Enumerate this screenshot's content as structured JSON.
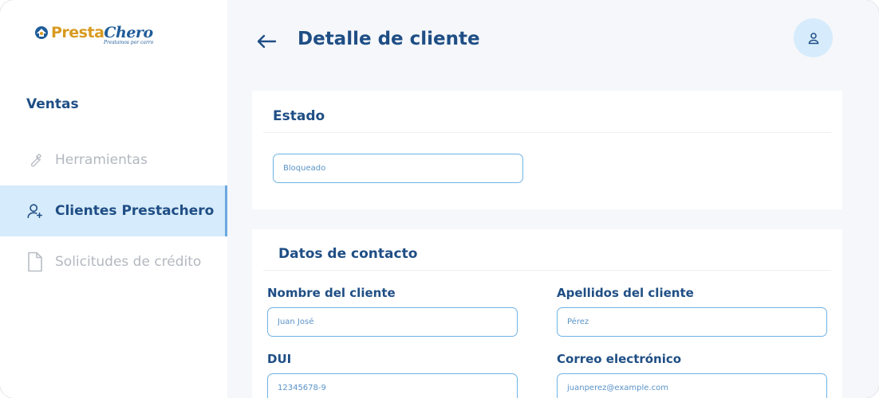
{
  "brand": {
    "name_part1": "Presta",
    "name_part2": "Chero",
    "tagline": "Prestamos por carro"
  },
  "sidebar": {
    "section_title": "Ventas",
    "items": [
      {
        "label": "Herramientas",
        "icon": "wrench-icon",
        "active": false
      },
      {
        "label": "Clientes Prestachero",
        "icon": "user-plus-icon",
        "active": true
      },
      {
        "label": "Solicitudes de crédito",
        "icon": "document-icon",
        "active": false
      }
    ]
  },
  "header": {
    "title": "Detalle de cliente",
    "back_icon": "arrow-left-icon",
    "avatar_icon": "user-icon"
  },
  "estado": {
    "title": "Estado",
    "value": "Bloqueado"
  },
  "contacto": {
    "title": "Datos de contacto",
    "fields": {
      "nombre": {
        "label": "Nombre del cliente",
        "value": "Juan José"
      },
      "apellidos": {
        "label": "Apellidos del cliente",
        "value": "Pérez"
      },
      "dui": {
        "label": "DUI",
        "value": "12345678-9"
      },
      "correo": {
        "label": "Correo electrónico",
        "value": "juanperez@example.com"
      }
    }
  },
  "colors": {
    "primary": "#1f4e85",
    "accent_light": "#d6ebfb",
    "input_border": "#6fb3e6",
    "brand_gold": "#d89a20"
  }
}
